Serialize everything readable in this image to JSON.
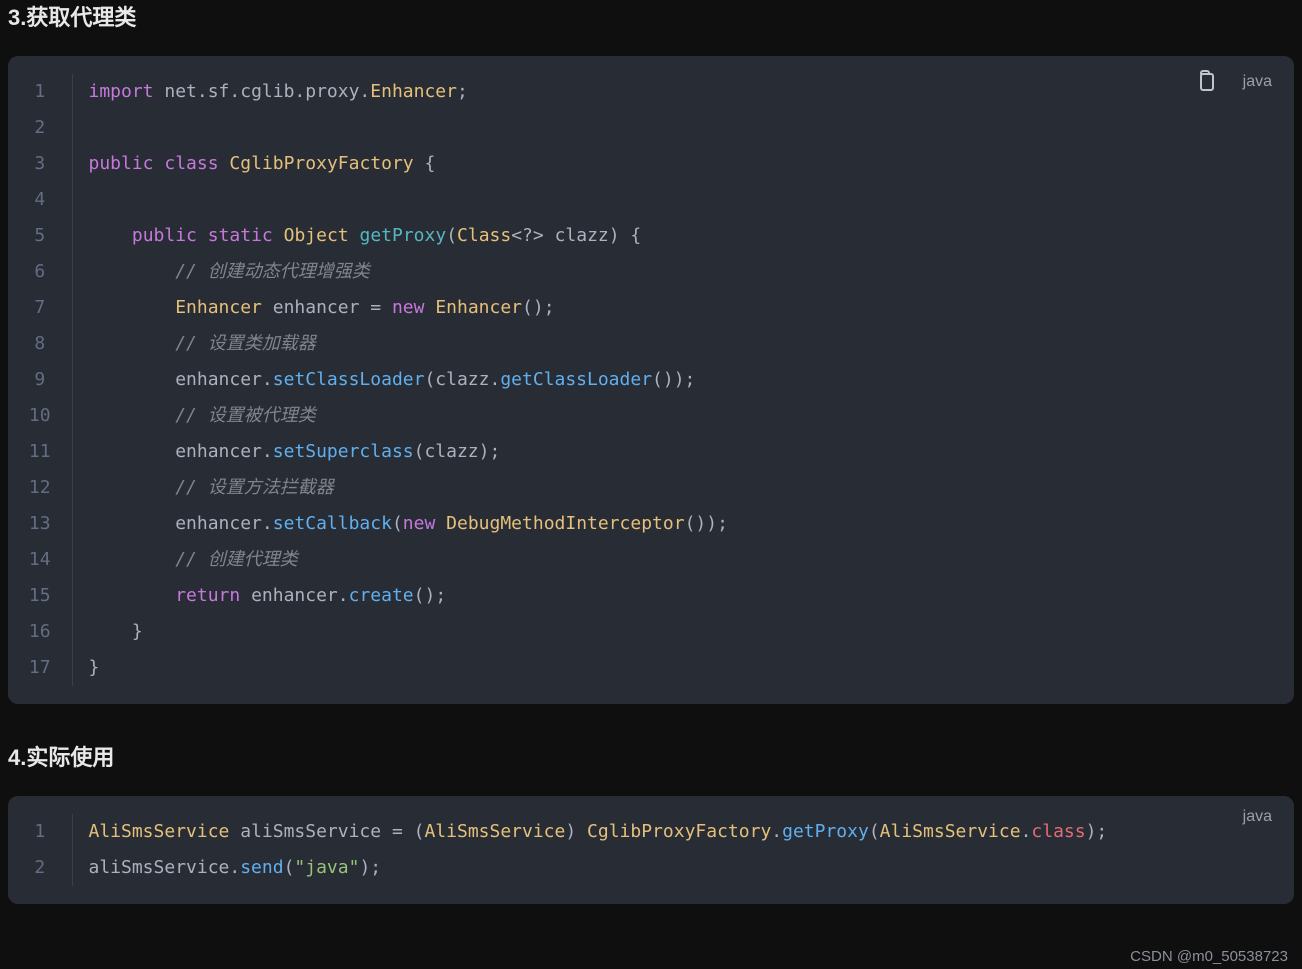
{
  "headings": {
    "h3": "3.获取代理类",
    "h4": "4.实际使用"
  },
  "block1": {
    "lang": "java",
    "lines": [
      [
        {
          "c": "tok-keyword",
          "t": "import"
        },
        {
          "c": "tok-punct",
          "t": " net.sf.cglib.proxy."
        },
        {
          "c": "tok-type",
          "t": "Enhancer"
        },
        {
          "c": "tok-punct",
          "t": ";"
        }
      ],
      [],
      [
        {
          "c": "tok-keyword",
          "t": "public"
        },
        {
          "c": "tok-punct",
          "t": " "
        },
        {
          "c": "tok-keyword",
          "t": "class"
        },
        {
          "c": "tok-punct",
          "t": " "
        },
        {
          "c": "tok-type",
          "t": "CglibProxyFactory"
        },
        {
          "c": "tok-punct",
          "t": " {"
        }
      ],
      [],
      [
        {
          "c": "tok-punct",
          "t": "    "
        },
        {
          "c": "tok-keyword",
          "t": "public"
        },
        {
          "c": "tok-punct",
          "t": " "
        },
        {
          "c": "tok-keyword",
          "t": "static"
        },
        {
          "c": "tok-punct",
          "t": " "
        },
        {
          "c": "tok-type",
          "t": "Object"
        },
        {
          "c": "tok-punct",
          "t": " "
        },
        {
          "c": "tok-method-decl",
          "t": "getProxy"
        },
        {
          "c": "tok-punct",
          "t": "("
        },
        {
          "c": "tok-type",
          "t": "Class"
        },
        {
          "c": "tok-punct",
          "t": "<?> clazz) {"
        }
      ],
      [
        {
          "c": "tok-punct",
          "t": "        "
        },
        {
          "c": "tok-comment",
          "t": "// 创建动态代理增强类"
        }
      ],
      [
        {
          "c": "tok-punct",
          "t": "        "
        },
        {
          "c": "tok-type",
          "t": "Enhancer"
        },
        {
          "c": "tok-punct",
          "t": " enhancer = "
        },
        {
          "c": "tok-keyword",
          "t": "new"
        },
        {
          "c": "tok-punct",
          "t": " "
        },
        {
          "c": "tok-type",
          "t": "Enhancer"
        },
        {
          "c": "tok-punct",
          "t": "();"
        }
      ],
      [
        {
          "c": "tok-punct",
          "t": "        "
        },
        {
          "c": "tok-comment",
          "t": "// 设置类加载器"
        }
      ],
      [
        {
          "c": "tok-punct",
          "t": "        enhancer."
        },
        {
          "c": "tok-method",
          "t": "setClassLoader"
        },
        {
          "c": "tok-punct",
          "t": "(clazz."
        },
        {
          "c": "tok-method",
          "t": "getClassLoader"
        },
        {
          "c": "tok-punct",
          "t": "());"
        }
      ],
      [
        {
          "c": "tok-punct",
          "t": "        "
        },
        {
          "c": "tok-comment",
          "t": "// 设置被代理类"
        }
      ],
      [
        {
          "c": "tok-punct",
          "t": "        enhancer."
        },
        {
          "c": "tok-method",
          "t": "setSuperclass"
        },
        {
          "c": "tok-punct",
          "t": "(clazz);"
        }
      ],
      [
        {
          "c": "tok-punct",
          "t": "        "
        },
        {
          "c": "tok-comment",
          "t": "// 设置方法拦截器"
        }
      ],
      [
        {
          "c": "tok-punct",
          "t": "        enhancer."
        },
        {
          "c": "tok-method",
          "t": "setCallback"
        },
        {
          "c": "tok-punct",
          "t": "("
        },
        {
          "c": "tok-keyword",
          "t": "new"
        },
        {
          "c": "tok-punct",
          "t": " "
        },
        {
          "c": "tok-type",
          "t": "DebugMethodInterceptor"
        },
        {
          "c": "tok-punct",
          "t": "());"
        }
      ],
      [
        {
          "c": "tok-punct",
          "t": "        "
        },
        {
          "c": "tok-comment",
          "t": "// 创建代理类"
        }
      ],
      [
        {
          "c": "tok-punct",
          "t": "        "
        },
        {
          "c": "tok-keyword",
          "t": "return"
        },
        {
          "c": "tok-punct",
          "t": " enhancer."
        },
        {
          "c": "tok-method",
          "t": "create"
        },
        {
          "c": "tok-punct",
          "t": "();"
        }
      ],
      [
        {
          "c": "tok-punct",
          "t": "    }"
        }
      ],
      [
        {
          "c": "tok-punct",
          "t": "}"
        }
      ]
    ]
  },
  "block2": {
    "lang": "java",
    "lines": [
      [
        {
          "c": "tok-type",
          "t": "AliSmsService"
        },
        {
          "c": "tok-punct",
          "t": " aliSmsService = ("
        },
        {
          "c": "tok-type",
          "t": "AliSmsService"
        },
        {
          "c": "tok-punct",
          "t": ") "
        },
        {
          "c": "tok-type",
          "t": "CglibProxyFactory"
        },
        {
          "c": "tok-punct",
          "t": "."
        },
        {
          "c": "tok-method",
          "t": "getProxy"
        },
        {
          "c": "tok-punct",
          "t": "("
        },
        {
          "c": "tok-type",
          "t": "AliSmsService"
        },
        {
          "c": "tok-punct",
          "t": "."
        },
        {
          "c": "tok-ident",
          "t": "class"
        },
        {
          "c": "tok-punct",
          "t": ");"
        }
      ],
      [
        {
          "c": "tok-punct",
          "t": "aliSmsService."
        },
        {
          "c": "tok-method",
          "t": "send"
        },
        {
          "c": "tok-punct",
          "t": "("
        },
        {
          "c": "tok-string",
          "t": "\"java\""
        },
        {
          "c": "tok-punct",
          "t": ");"
        }
      ]
    ]
  },
  "watermark": "CSDN @m0_50538723"
}
